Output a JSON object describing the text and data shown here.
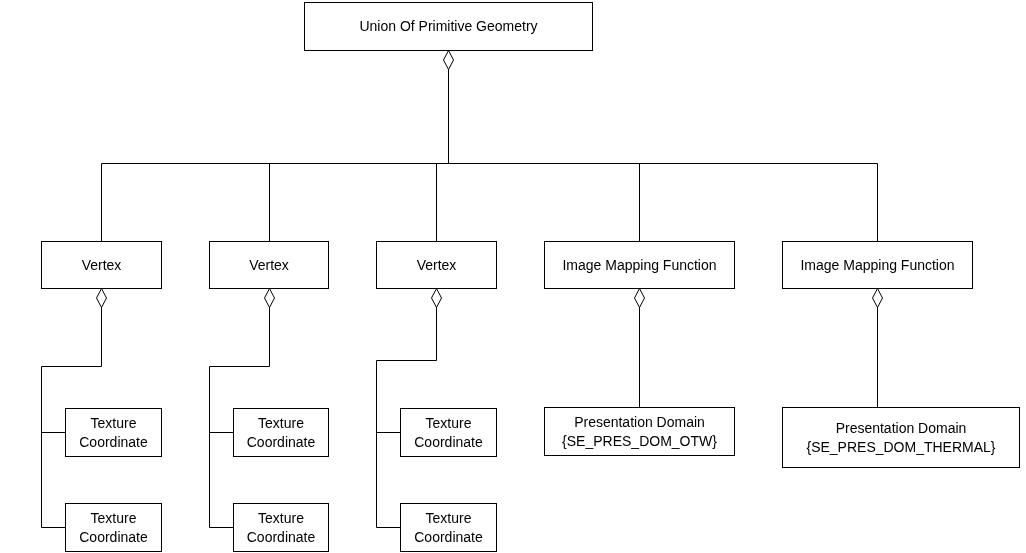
{
  "diagram": {
    "root": {
      "label": "Union Of Primitive Geometry",
      "children": [
        {
          "label": "Vertex",
          "children": [
            {
              "label": "Texture Coordinate"
            },
            {
              "label": "Texture Coordinate"
            }
          ]
        },
        {
          "label": "Vertex",
          "children": [
            {
              "label": "Texture Coordinate"
            },
            {
              "label": "Texture Coordinate"
            }
          ]
        },
        {
          "label": "Vertex",
          "children": [
            {
              "label": "Texture Coordinate"
            },
            {
              "label": "Texture Coordinate"
            }
          ]
        },
        {
          "label": "Image Mapping Function",
          "children": [
            {
              "label": "Presentation Domain {SE_PRES_DOM_OTW}"
            }
          ]
        },
        {
          "label": "Image Mapping Function",
          "children": [
            {
              "label": "Presentation Domain {SE_PRES_DOM_THERMAL}"
            }
          ]
        }
      ]
    }
  }
}
